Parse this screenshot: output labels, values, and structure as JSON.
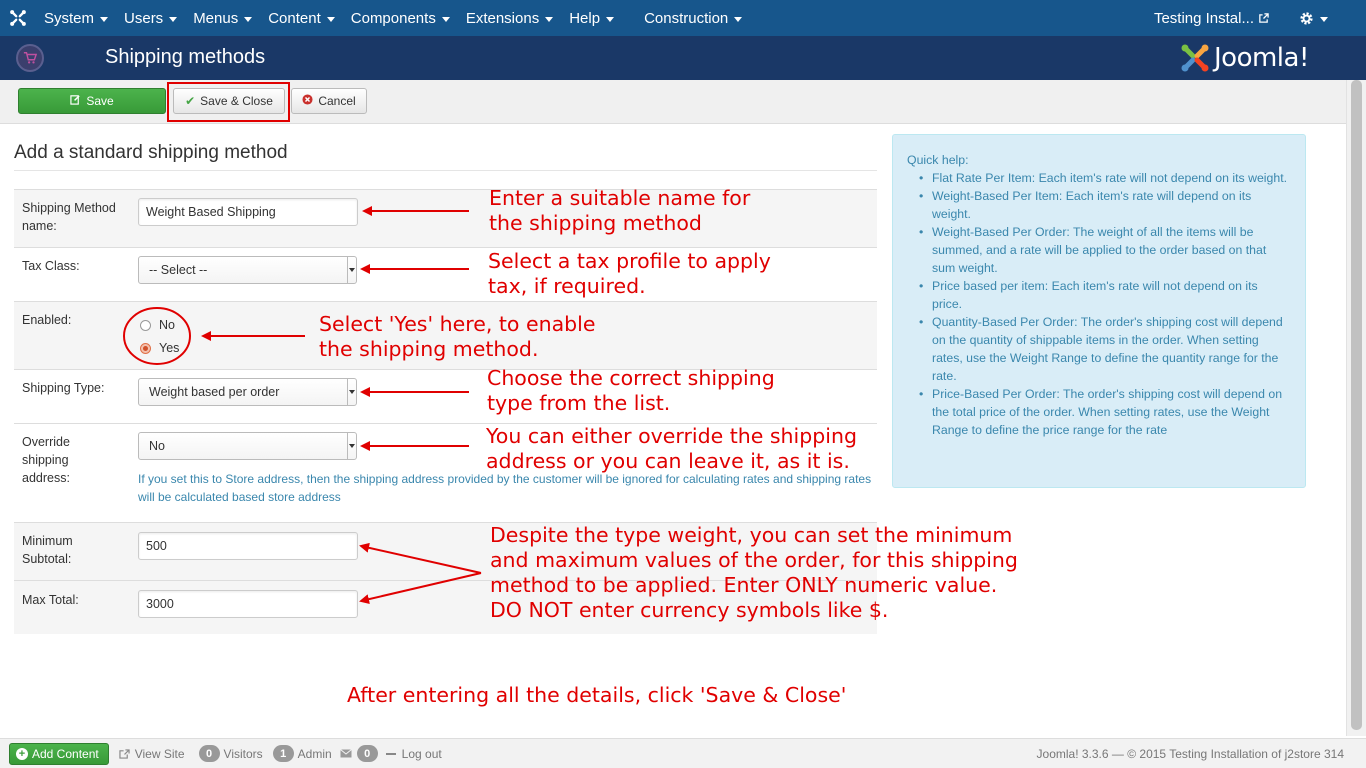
{
  "navbar": {
    "items": [
      {
        "label": "System"
      },
      {
        "label": "Users"
      },
      {
        "label": "Menus"
      },
      {
        "label": "Content"
      },
      {
        "label": "Components"
      },
      {
        "label": "Extensions"
      },
      {
        "label": "Help"
      },
      {
        "label": "Construction"
      }
    ],
    "site_link": "Testing Instal...",
    "icons": {
      "logo": "joomla-icon",
      "external": "external-link-icon",
      "settings": "gear-icon"
    }
  },
  "header": {
    "title": "Shipping methods",
    "brand": "Joomla!"
  },
  "toolbar": {
    "save_label": "Save",
    "save_close_label": "Save & Close",
    "cancel_label": "Cancel"
  },
  "form": {
    "heading": "Add a standard shipping method",
    "name_label": "Shipping Method name:",
    "name_value": "Weight Based Shipping",
    "tax_label": "Tax Class:",
    "tax_value": "-- Select --",
    "enabled_label": "Enabled:",
    "enabled_no": "No",
    "enabled_yes": "Yes",
    "type_label": "Shipping Type:",
    "type_value": "Weight based per order",
    "override_label": "Override shipping address:",
    "override_value": "No",
    "override_help": "If you set this to Store address, then the shipping address provided by the customer will be ignored for calculating rates and shipping rates will be calculated based store address",
    "min_label": "Minimum Subtotal:",
    "min_value": "500",
    "max_label": "Max Total:",
    "max_value": "3000"
  },
  "annotations": {
    "name": "Enter a suitable name for\nthe shipping method",
    "tax": "Select a tax profile to apply\ntax, if required.",
    "enabled": "Select 'Yes' here, to enable\nthe shipping method.",
    "type": "Choose the correct shipping\ntype from the list.",
    "override": "You can either override the shipping\naddress or you can leave it, as it is.",
    "minmax": "Despite the type weight, you can set the minimum\nand maximum values of the order, for this shipping\nmethod to be applied. Enter ONLY numeric value.\nDO NOT enter currency symbols like $.",
    "final": "After entering all the details, click 'Save & Close'",
    "color": "#e00000"
  },
  "quick_help": {
    "title": "Quick help:",
    "items": [
      "Flat Rate Per Item: Each item's rate will not depend on its weight.",
      "Weight-Based Per Item: Each item's rate will depend on its weight.",
      "Weight-Based Per Order: The weight of all the items will be summed, and a rate will be applied to the order based on that sum weight.",
      "Price based per item: Each item's rate will not depend on its price.",
      "Quantity-Based Per Order: The order's shipping cost will depend on the quantity of shippable items in the order. When setting rates, use the Weight Range to define the quantity range for the rate.",
      "Price-Based Per Order: The order's shipping cost will depend on the total price of the order. When setting rates, use the Weight Range to define the price range for the rate"
    ]
  },
  "footer": {
    "add_content": "Add Content",
    "view_site": "View Site",
    "visitors_count": "0",
    "visitors_label": "Visitors",
    "admin_count": "1",
    "admin_label": "Admin",
    "messages_count": "0",
    "logout": "Log out",
    "copyright": "Joomla! 3.3.6 — © 2015 Testing Installation of j2store 314"
  },
  "colors": {
    "navbar": "#17568c",
    "header": "#1a3867",
    "success": "#46a546",
    "info_bg": "#d9edf7",
    "info_text": "#3a87ad"
  }
}
